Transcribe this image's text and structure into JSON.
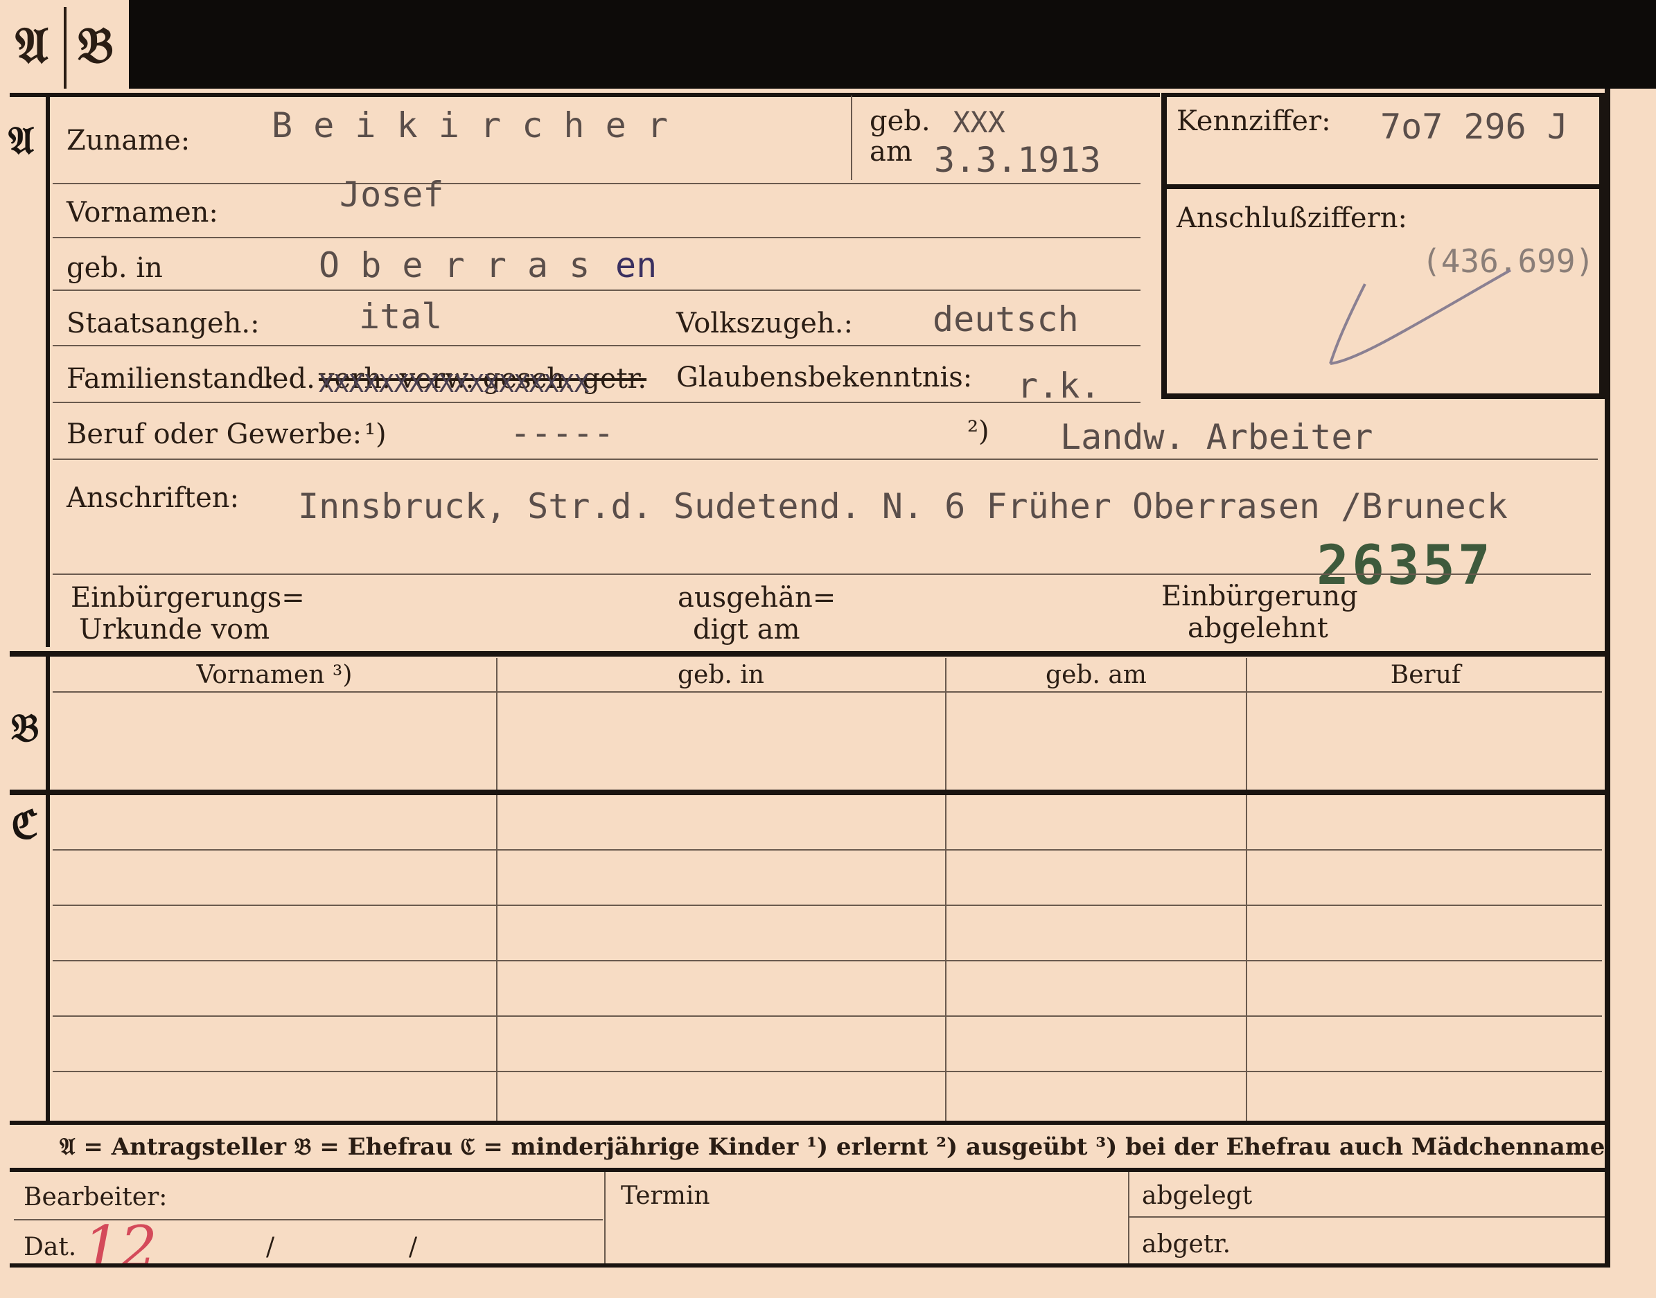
{
  "tabs": {
    "a": "𝔄",
    "b": "𝔅"
  },
  "sections": {
    "a": "𝔄",
    "b": "𝔅",
    "c": "ℭ"
  },
  "form": {
    "surname_label": "Zuname:",
    "surname_value": "B e i k i r c h e r",
    "birth_label_1": "geb.",
    "birth_label_2": "am",
    "birth_struck": "XXX",
    "birth_date": "3.3.1913",
    "firstname_label": "Vornamen:",
    "firstname_value": "Josef",
    "birthplace_label": "geb. in",
    "birthplace_value": "O b e r r a s",
    "birthplace_suffix": "en",
    "citizenship_label": "Staatsangeh.:",
    "citizenship_value": "ital",
    "ethnicity_label": "Volkszugeh.:",
    "ethnicity_value": "deutsch",
    "family_label": "Familienstand:",
    "family_options_kept": "led.",
    "family_options_struck": "verh. verw. gesch. getr.",
    "family_overtype": "XXXXXXXXXXXXXXXXXX",
    "religion_label": "Glaubensbekenntnis:",
    "religion_value": "r.k.",
    "profession_label": "Beruf oder Gewerbe:",
    "profession_note_1": "¹)",
    "profession_value_1": "-----",
    "profession_note_2": "²)",
    "profession_value_2": "Landw.  Arbeiter",
    "address_label": "Anschriften:",
    "address_value": "Innsbruck, Str.d. Sudetend. N. 6 Früher Oberrasen /Bruneck",
    "stamp_number": "26357",
    "naturalization_cert_1": "Einbürgerungs=",
    "naturalization_cert_2": "Urkunde vom",
    "handed_out_1": "ausgehän=",
    "handed_out_2": "digt am",
    "naturalization_denied_1": "Einbürgerung",
    "naturalization_denied_2": "abgelehnt"
  },
  "id_box": {
    "kennziffer_label": "Kennziffer:",
    "kennziffer_value": "7o7 296 J",
    "anschluss_label": "Anschlußziffern:",
    "anschluss_value": "(436.699)"
  },
  "table": {
    "headers": [
      "Vornamen ³)",
      "geb. in",
      "geb. am",
      "Beruf"
    ]
  },
  "legend": "𝔄 = Antragsteller   𝔅 = Ehefrau   ℭ = minderjährige Kinder   ¹) erlernt   ²) ausgeübt   ³) bei der Ehefrau auch Mädchenname",
  "footer": {
    "processor_label": "Bearbeiter:",
    "date_label": "Dat.",
    "date_handwritten": "12",
    "date_sep_1": "/",
    "date_sep_2": "/",
    "appointment_label": "Termin",
    "filed_label": "abgelegt",
    "separated_label": "abgetr."
  }
}
